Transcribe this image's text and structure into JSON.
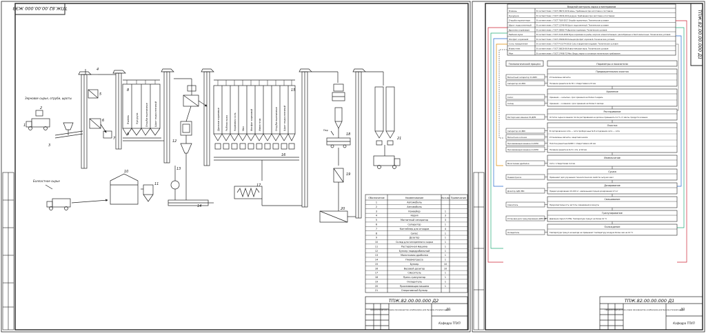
{
  "left_sheet": {
    "corner_code": "ТПЖ.82.00.00.000 ЖЭЗ",
    "labels": {
      "grain_input": "Зерновое сырье, отруби, шроты",
      "ballast_input": "Балластное сырье",
      "silo_names_a": [
        "Ячмень",
        "Кукуруза",
        "Отруби пшеничные",
        "Шрот подсолнечный"
      ],
      "silo_names_b": [
        "Дрожжи кормовые",
        "Рыбная мука",
        "Кормовая соль",
        "Мел",
        "Фосфат кормовой",
        "Известняк",
        "Отруби пшеничные",
        "Шрот подсолнечный"
      ],
      "mel_label": "Мел",
      "aux_label": "Пар"
    },
    "numbers": [
      "1",
      "2",
      "3",
      "4",
      "5",
      "6",
      "7",
      "8",
      "9",
      "10",
      "11",
      "12",
      "13",
      "14",
      "15",
      "16",
      "17",
      "18",
      "19",
      "20",
      "21"
    ],
    "spec_table": {
      "headers": [
        "Обозначение",
        "Наименование",
        "Кол-во",
        "Примечание"
      ],
      "rows": [
        [
          "1",
          "Автомобиль",
          "",
          ""
        ],
        [
          "2",
          "Автомобиль",
          "",
          ""
        ],
        [
          "3",
          "Конвейер",
          "1",
          ""
        ],
        [
          "4",
          "Нория",
          "3",
          ""
        ],
        [
          "5",
          "Магнитный сепаратор",
          "3",
          ""
        ],
        [
          "6",
          "Сепаратор",
          "1",
          ""
        ],
        [
          "7",
          "Контейнер для отходов",
          "4",
          ""
        ],
        [
          "8",
          "Силос",
          "1",
          ""
        ],
        [
          "9",
          "Дозатор",
          "1",
          ""
        ],
        [
          "10",
          "Склад для затаренного сырья",
          "1",
          ""
        ],
        [
          "11",
          "Растарочная машина",
          "1",
          ""
        ],
        [
          "12",
          "Бункер надвдробильный",
          "1",
          ""
        ],
        [
          "13",
          "Молотковая дробилка",
          "1",
          ""
        ],
        [
          "14",
          "Пневмотрасса",
          "1",
          ""
        ],
        [
          "15",
          "Бункер",
          "10",
          ""
        ],
        [
          "16",
          "Весовой дозатор",
          "10",
          ""
        ],
        [
          "17",
          "Смеситель",
          "1",
          ""
        ],
        [
          "18",
          "Пресс-гранулятор",
          "1",
          ""
        ],
        [
          "19",
          "Охладитель",
          "1",
          ""
        ],
        [
          "20",
          "Просеивающая машина",
          "1",
          ""
        ],
        [
          "21",
          "Оперативный бункер",
          "",
          ""
        ]
      ]
    },
    "stamp": {
      "code": "ТПЖ.82.00.00.000 Д2",
      "title": "Технологическая схема производства комбикорма для бычков-откормочников",
      "org": "Кафедра ТПХП",
      "stage": "ДП"
    }
  },
  "right_sheet": {
    "corner_code": "ТПЖ.82.00.00.000 Д1",
    "quality_header": "Входной контроль сырья и материалов",
    "quality_rows": [
      [
        "Ячмень",
        "В соответствии с ГОСТ 28672-90 Ячмень. Требования при заготовке и поставках"
      ],
      [
        "Кукуруза",
        "В соответствии с ГОСТ 13634-90 Кукуруза. Требования при заготовке и поставках"
      ],
      [
        "Отруби пшеничные",
        "В соответствии с ГОСТ 7169-2017 Отруби пшеничные. Технические условия"
      ],
      [
        "Шрот подсолнечный",
        "В соответствии с ГОСТ 11246-96 Шрот подсолнечный. Технические условия"
      ],
      [
        "Дрожжи кормовые",
        "В соответствии с ГОСТ 20083-74 Дрожжи кормовые. Технические условия"
      ],
      [
        "Рыбная мука",
        "В соответствии с ГОСТ 2116-2000 Мука кормовая из рыбы, морских млекопитающих, ракообразных и беспозвоночных. Технические условия"
      ],
      [
        "Фосфат кормовой",
        "В соответствии с ГОСТ 23999-80 Кальция фосфат кормовой. Технические условия"
      ],
      [
        "Соль поваренная",
        "В соответствии с ГОСТ Р 51574-2018 Соль поваренная пищевая. Технические условия"
      ],
      [
        "Известняк",
        "В соответствии с ГОСТ 26826-86 Известняковая мука. Технические условия"
      ],
      [
        "Мел",
        "В соответствии с ГОСТ 17498-72 Мел. Виды, марки и основные технические требования"
      ]
    ],
    "process_header": "Технологический процесс",
    "params_header": "Параметры и показатели",
    "sections": [
      {
        "title": "Предварительная очистка",
        "rows": [
          [
            "Магнитный сепаратор У1-БМЗ",
            "Установлены магниты"
          ],
          [
            "Сепаратор А1-БЗО",
            "Посевное решетное № 30 с отверстиями в 15 мм"
          ]
        ]
      },
      {
        "title": "Хранение",
        "rows": [
          [
            "Силос",
            "Хранение — насыпью, срок хранения не более 2 недель"
          ],
          [
            "Склад",
            "Хранение — в мешках, срок хранения не более 1 месяца"
          ]
        ]
      },
      {
        "title": "Растаривание",
        "rows": [
          [
            "Растарочная машина У2-ДРМ",
            "Остаток сырья в мешках после растаривания не должен превышать 0,2 % от массы продукта в мешке"
          ]
        ]
      },
      {
        "title": "Очистка",
        "rows": [
          [
            "Сепаратор А1-БИС",
            "В сортировочном сите — сита проборочные № 8 в подсевном сите — сита"
          ],
          [
            "Магнитная колонка",
            "Установлены магниты, защитная шкала"
          ],
          [
            "Просеивающая машина А1-БПО",
            "Полотна решетные №000 с отверстиями в 20 мм"
          ],
          [
            "Просеивающая машина А1-БПО",
            "Посевное решетное № 8 с отв. в 8,8 мм"
          ]
        ]
      },
      {
        "title": "Измельчение",
        "rows": [
          [
            "Молотковая дробилка",
            "Сито с отверстиями 4-2 мм"
          ]
        ]
      },
      {
        "title": "Сушка",
        "rows": [
          [
            "Пневмотрасса",
            "Применяют для улучшения технологических свойств сыпучих масс"
          ]
        ]
      },
      {
        "title": "Дозирование",
        "rows": [
          [
            "Дозатор АД5-ЗВС",
            "Предел дозирования 10-100 кг, наименьшая порция дозирования 2,5 кг"
          ]
        ]
      },
      {
        "title": "Смешивание",
        "rows": [
          [
            "Смеситель",
            "Продолжительность частоты смешивания в минуты"
          ]
        ]
      },
      {
        "title": "Гранулирование",
        "rows": [
          [
            "Установка для гранулирования ДГВ-1М",
            "Давление пара 0,5 МПа. Температура гранул не более 10 °С"
          ]
        ]
      },
      {
        "title": "Охлаждение",
        "rows": [
          [
            "Охладитель",
            "Температура гранул на выходе не превышает температуру воздуха более чем на 10 °С"
          ]
        ]
      }
    ],
    "stamp": {
      "code": "ТПЖ.82.00.00.000 Д1",
      "title": "Технологическая блок-схема производства комбикорма для бычков-откормочников",
      "org": "Кафедра ТПХП",
      "stage": "ДП"
    }
  }
}
